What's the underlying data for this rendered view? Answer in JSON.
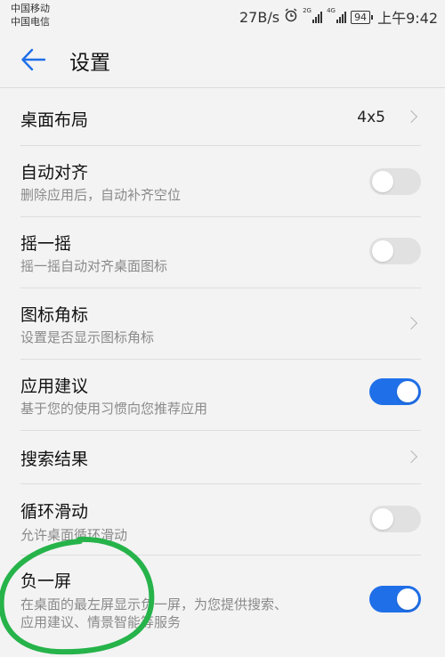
{
  "status_bar": {
    "carrier_1": "中国移动",
    "carrier_2": "中国电信",
    "net_speed": "27B/s",
    "sig1_tag": "2G",
    "sig2_tag": "4G",
    "battery": "94",
    "time": "上午9:42",
    "icons": [
      "alarm-icon",
      "signal-icon",
      "signal-icon",
      "battery-icon"
    ]
  },
  "header": {
    "title": "设置",
    "back_icon": "arrow-left-icon"
  },
  "accent_color": "#1f6fe8",
  "settings": [
    {
      "label": "桌面布局",
      "value": "4x5",
      "control": "chevron"
    },
    {
      "label": "自动对齐",
      "desc": "删除应用后，自动补齐空位",
      "control": "toggle",
      "on": false
    },
    {
      "label": "摇一摇",
      "desc": "摇一摇自动对齐桌面图标",
      "control": "toggle",
      "on": false
    },
    {
      "label": "图标角标",
      "desc": "设置是否显示图标角标",
      "control": "chevron"
    },
    {
      "label": "应用建议",
      "desc": "基于您的使用习惯向您推荐应用",
      "control": "toggle",
      "on": true
    },
    {
      "label": "搜索结果",
      "control": "chevron"
    },
    {
      "label": "循环滑动",
      "desc": "允许桌面循环滑动",
      "control": "toggle",
      "on": false
    },
    {
      "label": "负一屏",
      "desc": "在桌面的最左屏显示负一屏，为您提供搜索、",
      "desc2": "应用建议、情景智能等服务",
      "control": "toggle",
      "on": true
    }
  ]
}
